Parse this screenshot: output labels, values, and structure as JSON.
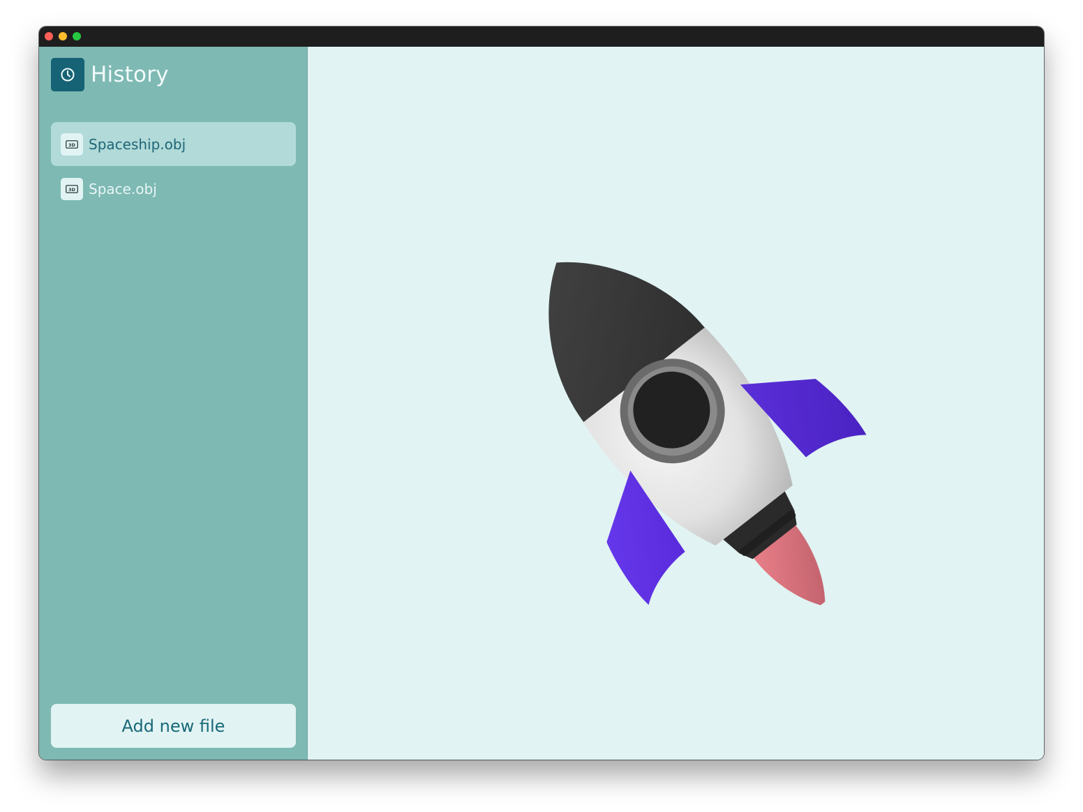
{
  "window": {
    "traffic_lights": [
      "close",
      "minimize",
      "zoom"
    ]
  },
  "sidebar": {
    "title": "History",
    "title_icon": "clock-icon",
    "files": [
      {
        "label": "Spaceship.obj",
        "icon": "3d-file-icon",
        "icon_text": "3D",
        "selected": true
      },
      {
        "label": "Space.obj",
        "icon": "3d-file-icon",
        "icon_text": "3D",
        "selected": false
      }
    ],
    "add_button_label": "Add new file"
  },
  "viewport": {
    "model": "rocket-3d-model"
  },
  "colors": {
    "sidebar_bg": "#7eb9b3",
    "selected_item_bg": "#b1dad8",
    "accent_dark_teal": "#156374",
    "viewport_bg": "#e1f3f3",
    "rocket_fin_purple": "#5b2ddf",
    "rocket_flame_pink": "#e0727c",
    "rocket_nose_dark": "#3b3b3b"
  }
}
